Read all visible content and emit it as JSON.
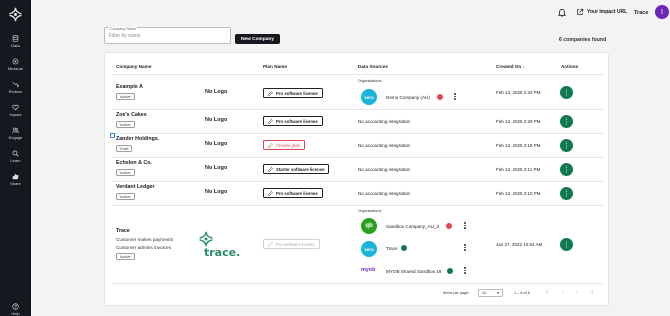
{
  "app": {
    "user_name": "Trace",
    "avatar_initial": "I",
    "impact_url_label": "Your Impact URL",
    "brand_color": "#0f7a52"
  },
  "sidebar": {
    "items": [
      {
        "label": "Data",
        "icon": "database-icon"
      },
      {
        "label": "Measure",
        "icon": "measure-icon"
      },
      {
        "label": "Reduce",
        "icon": "reduce-icon"
      },
      {
        "label": "Impact",
        "icon": "heart-icon"
      },
      {
        "label": "Engage",
        "icon": "users-icon"
      },
      {
        "label": "Learn",
        "icon": "search-icon"
      },
      {
        "label": "Share",
        "icon": "thumbs-up-icon"
      }
    ],
    "help_label": "Help"
  },
  "toolbar": {
    "filter_label": "Company Name",
    "filter_placeholder": "Filter by name",
    "new_company_label": "New Company",
    "companies_count": "6 companies found"
  },
  "table": {
    "headers": {
      "company": "Company Name",
      "plan": "Plan Name",
      "data_sources": "Data Sources",
      "created": "Created On",
      "created_sort": "↓",
      "actions": "Actions"
    },
    "organisations_label": "Organisations",
    "no_logo": "No Logo",
    "rows": [
      {
        "name": "Example A",
        "badge": "Active",
        "logo": "No Logo",
        "plan": "Pro software license",
        "data_source": "",
        "orgs": [
          {
            "name": "Demo Company (AU)",
            "provider": "xero",
            "status": "error"
          }
        ],
        "created": "Feb 13, 2025 2:32 PM"
      },
      {
        "name": "Zoe's Cakes",
        "badge": "Active",
        "logo": "No Logo",
        "plan": "Pro software license",
        "data_source": "No accounting integration",
        "created": "Feb 13, 2025 2:29 PM"
      },
      {
        "name": "Zander Holdings.",
        "badge": "Draft",
        "logo": "No Logo",
        "plan": "Choose plan",
        "data_source": "No accounting integration",
        "created": "Feb 13, 2025 2:18 PM"
      },
      {
        "name": "Echelon & Co.",
        "badge": "Active",
        "logo": "No Logo",
        "plan": "Starter software license",
        "data_source": "No accounting integration",
        "created": "Feb 13, 2025 2:11 PM"
      },
      {
        "name": "Verdant Ledger",
        "badge": "Active",
        "logo": "No Logo",
        "plan": "Pro software license",
        "data_source": "No accounting integration",
        "created": "Feb 13, 2025 2:10 PM"
      },
      {
        "name": "Trace",
        "note1": "Customer makes payments",
        "note2": "Customer admins invoices",
        "badge": "Active",
        "logo_text": "trace.",
        "plan": "Pro software license",
        "orgs": [
          {
            "name": "Sandbox Company_AU_2",
            "provider": "quickbooks",
            "provider_label": "qb",
            "status": "error"
          },
          {
            "name": "Trace",
            "provider": "xero",
            "provider_label": "xero",
            "status": "ok"
          },
          {
            "name": "MYOB Shared Sandbox 18",
            "provider": "myob",
            "provider_label": "myob",
            "status": "ok"
          }
        ],
        "created": "Jan 27, 2022 10:54 AM"
      }
    ]
  },
  "pagination": {
    "items_per_page_label": "Items per page:",
    "items_per_page": "10",
    "range": "1 – 6 of 6"
  },
  "colors": {
    "error": "#e0494f",
    "ok": "#0f7a52",
    "xero": "#1ab4d7",
    "quickbooks": "#2ca01c",
    "myob": "#6b2fbf"
  }
}
